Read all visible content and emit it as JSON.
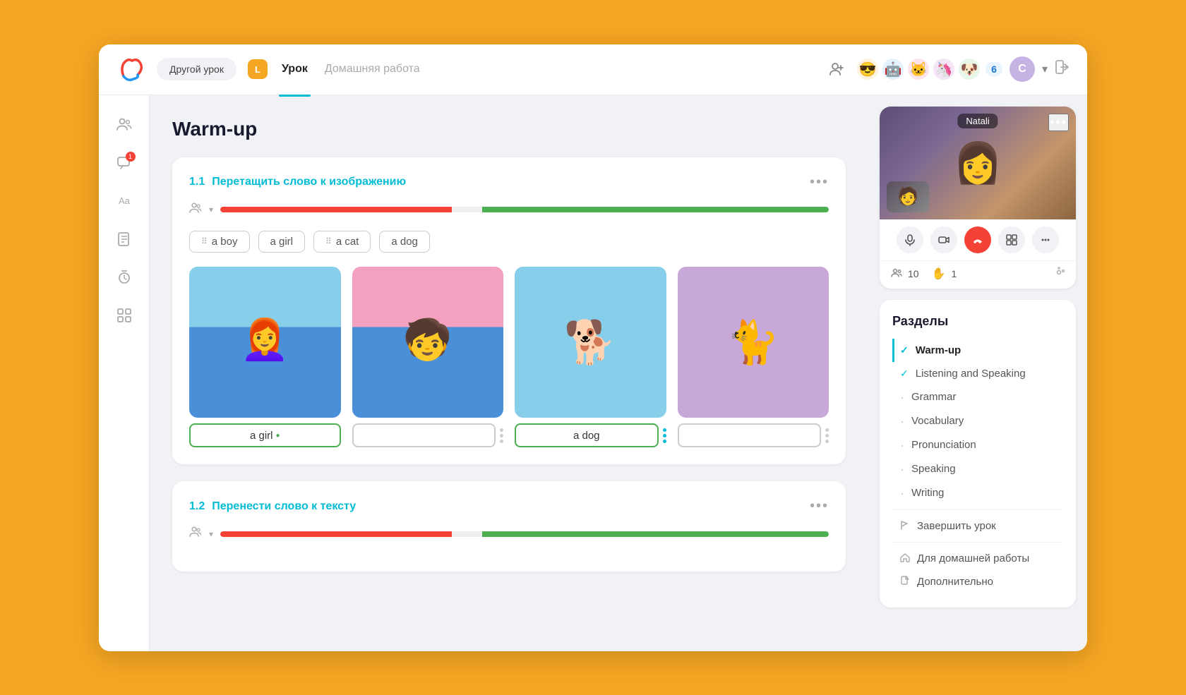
{
  "app": {
    "logo": "🔵",
    "nav": {
      "other_lesson_btn": "Другой урок",
      "label_badge": "L",
      "tab_lesson": "Урок",
      "tab_homework": "Домашняя работа"
    },
    "user": {
      "badge": "C",
      "participant_count": "6"
    }
  },
  "sidebar": {
    "icons": [
      {
        "name": "people-icon",
        "symbol": "👥"
      },
      {
        "name": "chat-icon",
        "symbol": "💬",
        "badge": "1"
      },
      {
        "name": "translate-icon",
        "symbol": "🔤"
      },
      {
        "name": "tasks-icon",
        "symbol": "📋"
      },
      {
        "name": "timer-icon",
        "symbol": "⏱"
      },
      {
        "name": "grid-icon",
        "symbol": "⊞"
      }
    ]
  },
  "main": {
    "page_title": "Warm-up",
    "exercises": [
      {
        "number": "1.1",
        "title": "Перетащить слово к изображению",
        "progress_red_pct": 38,
        "progress_green_pct": 57,
        "word_chips": [
          "a boy",
          "a girl",
          "a cat",
          "a dog"
        ],
        "images": [
          {
            "label": "a girl",
            "filled": true,
            "type": "girl"
          },
          {
            "label": "",
            "filled": false,
            "type": "boy"
          },
          {
            "label": "a dog",
            "filled": true,
            "type": "dog"
          },
          {
            "label": "",
            "filled": false,
            "type": "cat"
          }
        ]
      },
      {
        "number": "1.2",
        "title": "Перенести слово к тексту",
        "progress_red_pct": 38,
        "progress_green_pct": 57
      }
    ]
  },
  "right_panel": {
    "video": {
      "person_name": "Natali",
      "participants": "10",
      "raise_hand": "1"
    },
    "sections": {
      "title": "Разделы",
      "items": [
        {
          "label": "Warm-up",
          "state": "active_checked"
        },
        {
          "label": "Listening and Speaking",
          "state": "checked"
        },
        {
          "label": "Grammar",
          "state": "dot"
        },
        {
          "label": "Vocabulary",
          "state": "dot"
        },
        {
          "label": "Pronunciation",
          "state": "dot"
        },
        {
          "label": "Speaking",
          "state": "dot"
        },
        {
          "label": "Writing",
          "state": "dot"
        },
        {
          "label": "Завершить урок",
          "state": "flag"
        },
        {
          "label": "Для домашней работы",
          "state": "home"
        },
        {
          "label": "Дополнительно",
          "state": "file"
        }
      ]
    }
  },
  "emojis": [
    "😎",
    "🤖",
    "🐱",
    "🦄",
    "🐶"
  ],
  "controls": {
    "mic": "🎙",
    "video": "📹",
    "end": "📞",
    "grid": "⊞",
    "more": "⋯"
  }
}
